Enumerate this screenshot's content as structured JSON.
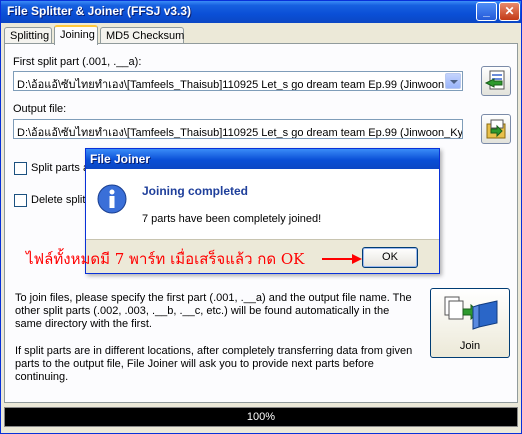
{
  "window": {
    "title": "File Splitter & Joiner (FFSJ v3.3)"
  },
  "tabs": [
    {
      "label": "Splitting"
    },
    {
      "label": "Joining"
    },
    {
      "label": "MD5 Checksum"
    }
  ],
  "joining": {
    "first_label": "First split part (.001, .__a):",
    "first_value": "D:\\อ้อแอ้\\ซับไทยทำเอง\\[Tamfeels_Thaisub]110925 Let_s go dream team Ep.99 (Jinwoon",
    "output_label": "Output file:",
    "output_value": "D:\\อ้อแอ้\\ซับไทยทำเอง\\[Tamfeels_Thaisub]110925 Let_s go dream team Ep.99 (Jinwoon_Ky",
    "split_parts_label": "Split parts a",
    "delete_split_label": "Delete split",
    "info_para1": "To join files, please specify the first part (.001, .__a) and the output file name. The other split parts (.002, .003, .__b, .__c, etc.) will be found automatically in the same directory with the first.",
    "info_para2": "If split parts are in different locations, after completely transferring data from given parts to the output file, File Joiner will ask you to provide next parts before continuing.",
    "join_label": "Join"
  },
  "progress": {
    "text": "100%",
    "percent": 100
  },
  "dialog": {
    "title": "File Joiner",
    "heading": "Joining completed",
    "message": "7 parts have been completely joined!",
    "ok_label": "OK"
  },
  "annotation": {
    "text": "ไฟล์ทั้งหมดมี 7 พาร์ท เมื่อเสร็จแล้ว กด OK"
  },
  "colors": {
    "accent": "#0a4fd6",
    "annotation": "#ff0000",
    "heading": "#1f3f9b"
  }
}
